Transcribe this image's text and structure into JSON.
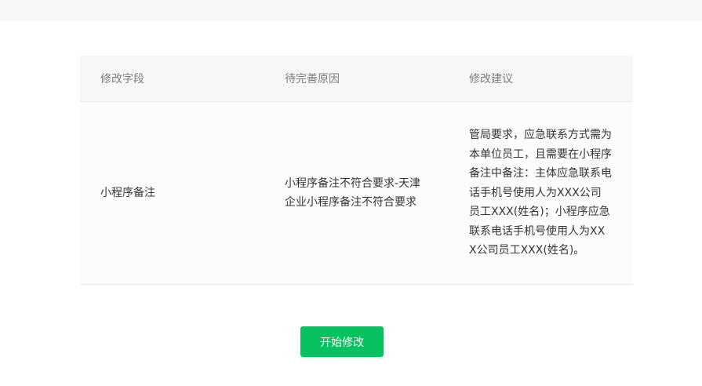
{
  "table": {
    "headers": [
      "修改字段",
      "待完善原因",
      "修改建议"
    ],
    "rows": [
      {
        "field": "小程序备注",
        "reason": "小程序备注不符合要求-天津企业小程序备注不符合要求",
        "suggestion": "管局要求，应急联系方式需为本单位员工，且需要在小程序备注中备注：主体应急联系电话手机号使用人为XXX公司员工XXX(姓名)；小程序应急联系电话手机号使用人为XXX公司员工XXX(姓名)。"
      }
    ]
  },
  "actions": {
    "start_edit_label": "开始修改"
  },
  "colors": {
    "primary": "#07c160",
    "header_bg": "#f6f7f8"
  }
}
